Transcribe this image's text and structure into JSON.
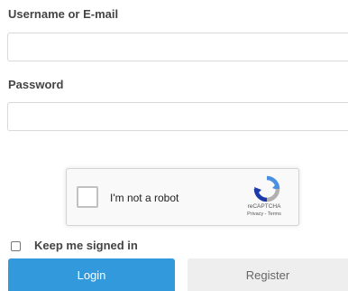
{
  "form": {
    "username_label": "Username or E-mail",
    "username_value": "",
    "password_label": "Password",
    "password_value": ""
  },
  "recaptcha": {
    "label": "I'm not a robot",
    "brand": "reCAPTCHA",
    "terms": "Privacy - Terms",
    "logo_icon": "recaptcha-logo-icon",
    "checked": false
  },
  "remember": {
    "label": "Keep me signed in",
    "checked": false
  },
  "actions": {
    "login_label": "Login",
    "register_label": "Register"
  },
  "colors": {
    "primary": "#3399dd",
    "secondary": "#eeeeee",
    "recaptcha_blue": "#4a90e2",
    "recaptcha_gray": "#b0b0b0"
  }
}
